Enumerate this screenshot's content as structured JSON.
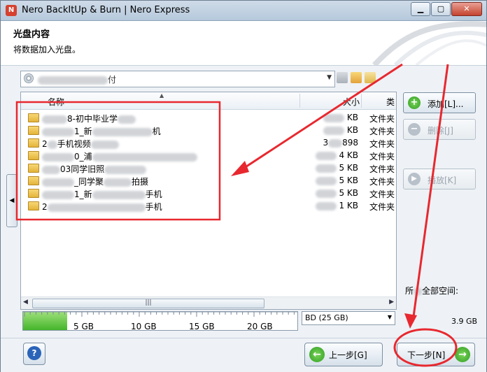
{
  "window": {
    "title": "Nero BackItUp & Burn | Nero Express",
    "icon": "nero-app-icon",
    "controls": [
      "minimize-icon",
      "maximize-icon",
      "close-icon"
    ]
  },
  "header": {
    "title": "光盘内容",
    "subtitle": "将数据加入光盘。"
  },
  "drive": {
    "label_tail": "付"
  },
  "list": {
    "columns": {
      "name": "名称",
      "size": "大小",
      "type": "类"
    },
    "rows": [
      {
        "name": "8-初中毕业学",
        "size": "KB",
        "type": "文件夹"
      },
      {
        "name": "1_新",
        "size": "KB",
        "type": "文件夹"
      },
      {
        "name": "手机视频",
        "size": "898",
        "type": "文件夹"
      },
      {
        "name": "0_浦",
        "size": "4 KB",
        "type": "文件夹"
      },
      {
        "name": "03同学旧照",
        "size": "5 KB",
        "type": "文件夹"
      },
      {
        "name": "_同学聚",
        "size": "5 KB",
        "type": "文件夹"
      },
      {
        "name": "1_新",
        "size": "5 KB",
        "type": "文件夹"
      },
      {
        "name": "2",
        "size": "1 KB",
        "type": "文件夹"
      }
    ]
  },
  "capacity": {
    "ticks": [
      "5 GB",
      "10 GB",
      "15 GB",
      "20 GB"
    ],
    "disc_type": "BD (25 GB)",
    "used_fraction": 0.16,
    "total_label": "所",
    "total_label_tail": "全部空间:",
    "total_value": "3.9 GB"
  },
  "buttons": {
    "add": "添加[L]...",
    "delete": "删除[J]",
    "play": "播放[K]",
    "back": "上一步[G]",
    "next": "下一步[N]"
  },
  "colors": {
    "annotation": "#e8282f",
    "progress": "#44b52a"
  }
}
